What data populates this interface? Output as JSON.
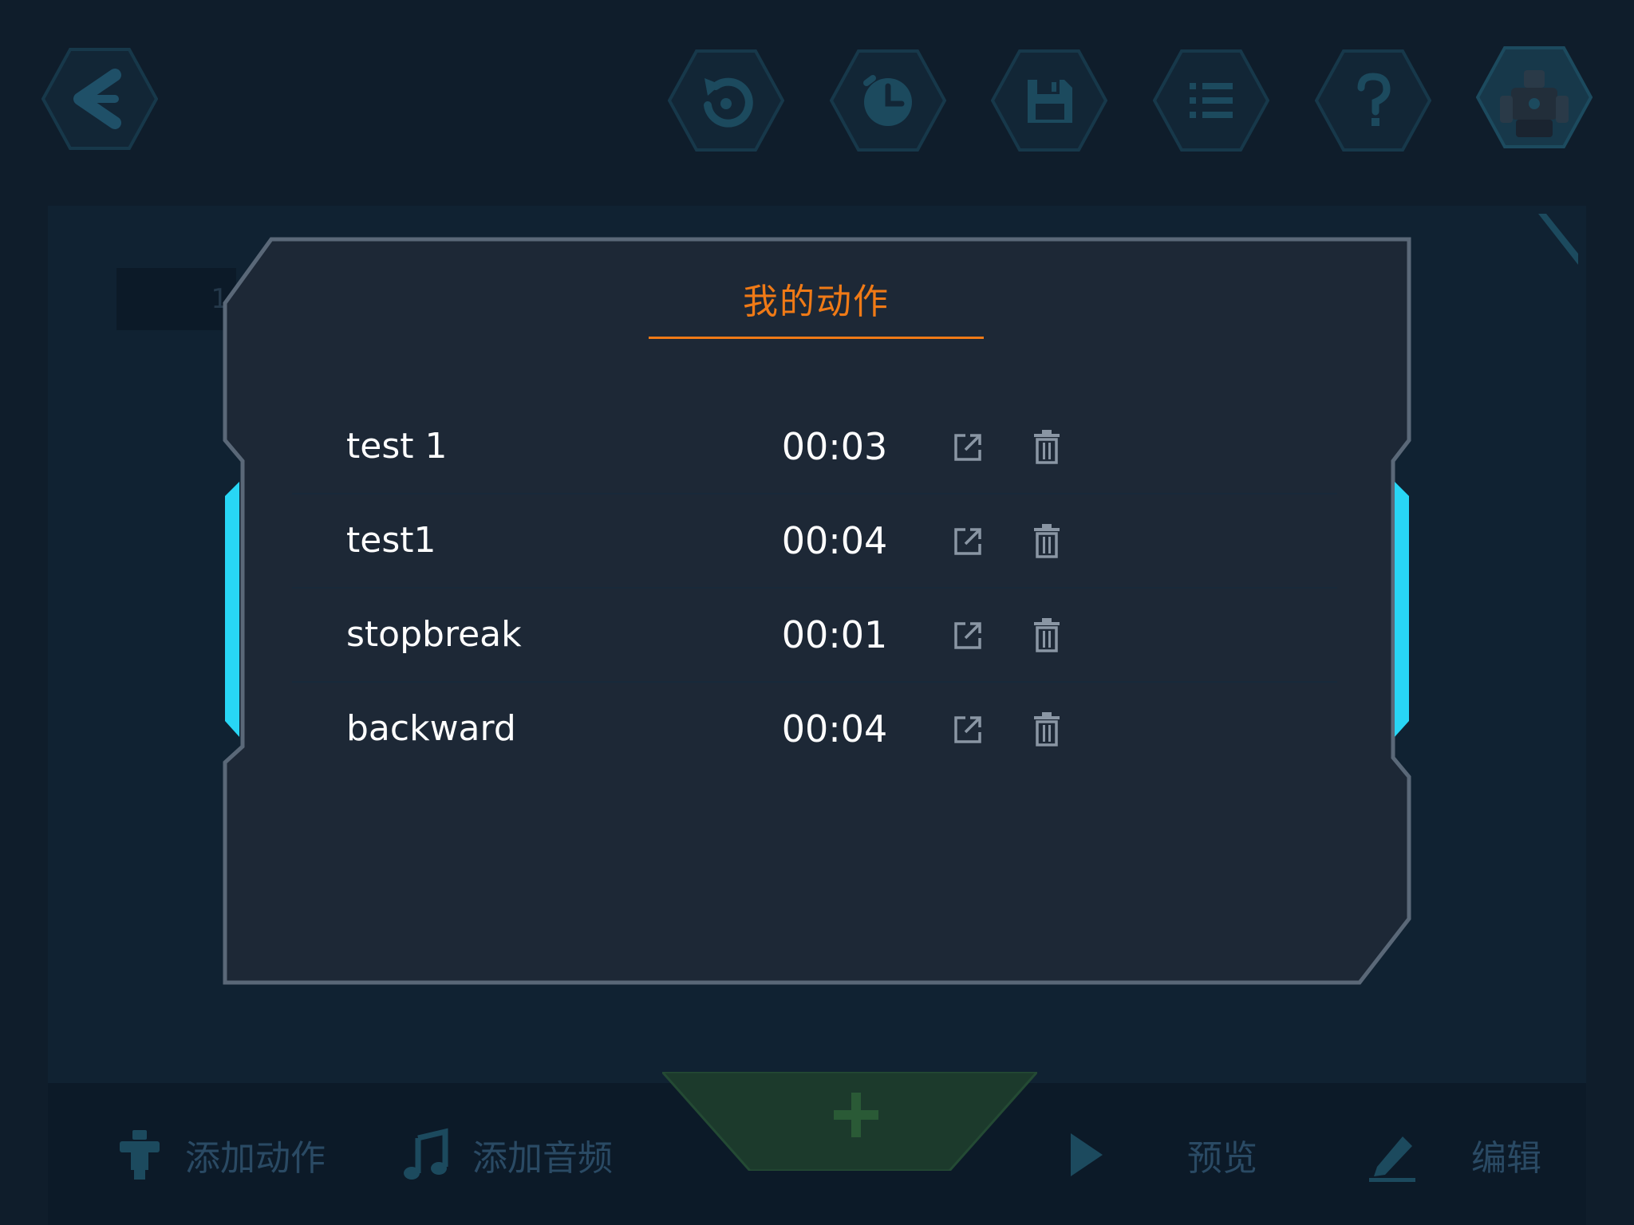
{
  "toolbar": {
    "back_icon": "back-arrow-icon",
    "buttons": [
      {
        "name": "reset",
        "icon": "reset-icon"
      },
      {
        "name": "timer",
        "icon": "clock-icon"
      },
      {
        "name": "save",
        "icon": "save-icon"
      },
      {
        "name": "list",
        "icon": "list-icon"
      },
      {
        "name": "help",
        "icon": "help-icon"
      },
      {
        "name": "robot",
        "icon": "robot-icon"
      }
    ]
  },
  "workspace": {
    "track_index": "1"
  },
  "modal": {
    "title": "我的动作",
    "actions": [
      {
        "name": "test 1",
        "duration": "00:03"
      },
      {
        "name": "test1",
        "duration": "00:04"
      },
      {
        "name": "stopbreak",
        "duration": "00:01"
      },
      {
        "name": "backward",
        "duration": "00:04"
      }
    ]
  },
  "bottom_bar": {
    "add_action": "添加动作",
    "add_audio": "添加音频",
    "preview": "预览",
    "edit": "编辑"
  },
  "colors": {
    "background": "#0f1d2b",
    "modal_bg": "#1d2836",
    "modal_border": "#5a6878",
    "accent": "#f07a16",
    "side_glow": "#28d6f5",
    "toolbar_dim": "#1c4a5e"
  }
}
